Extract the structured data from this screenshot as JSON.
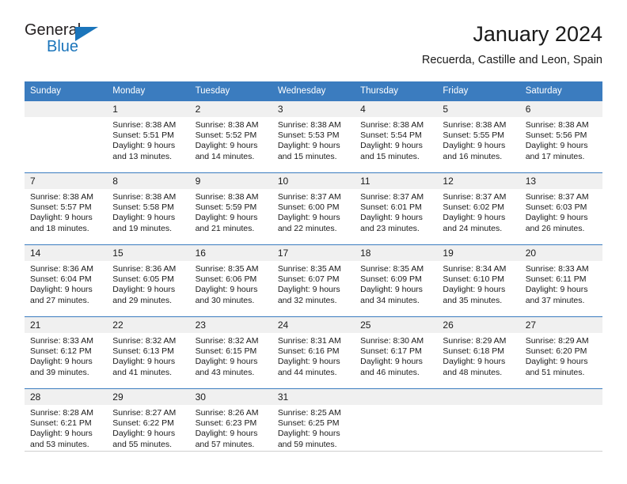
{
  "brand": {
    "name_part1": "General",
    "name_part2": "Blue",
    "triangle_color": "#1b75bb"
  },
  "header": {
    "title": "January 2024",
    "subtitle": "Recuerda, Castille and Leon, Spain"
  },
  "theme": {
    "header_bg": "#3b7cbf",
    "day_header_bg": "#f0f0f0",
    "text": "#1a1a1a"
  },
  "weekdays": [
    "Sunday",
    "Monday",
    "Tuesday",
    "Wednesday",
    "Thursday",
    "Friday",
    "Saturday"
  ],
  "weeks": [
    [
      {
        "day": "",
        "sunrise": "",
        "sunset": "",
        "daylight1": "",
        "daylight2": ""
      },
      {
        "day": "1",
        "sunrise": "Sunrise: 8:38 AM",
        "sunset": "Sunset: 5:51 PM",
        "daylight1": "Daylight: 9 hours",
        "daylight2": "and 13 minutes."
      },
      {
        "day": "2",
        "sunrise": "Sunrise: 8:38 AM",
        "sunset": "Sunset: 5:52 PM",
        "daylight1": "Daylight: 9 hours",
        "daylight2": "and 14 minutes."
      },
      {
        "day": "3",
        "sunrise": "Sunrise: 8:38 AM",
        "sunset": "Sunset: 5:53 PM",
        "daylight1": "Daylight: 9 hours",
        "daylight2": "and 15 minutes."
      },
      {
        "day": "4",
        "sunrise": "Sunrise: 8:38 AM",
        "sunset": "Sunset: 5:54 PM",
        "daylight1": "Daylight: 9 hours",
        "daylight2": "and 15 minutes."
      },
      {
        "day": "5",
        "sunrise": "Sunrise: 8:38 AM",
        "sunset": "Sunset: 5:55 PM",
        "daylight1": "Daylight: 9 hours",
        "daylight2": "and 16 minutes."
      },
      {
        "day": "6",
        "sunrise": "Sunrise: 8:38 AM",
        "sunset": "Sunset: 5:56 PM",
        "daylight1": "Daylight: 9 hours",
        "daylight2": "and 17 minutes."
      }
    ],
    [
      {
        "day": "7",
        "sunrise": "Sunrise: 8:38 AM",
        "sunset": "Sunset: 5:57 PM",
        "daylight1": "Daylight: 9 hours",
        "daylight2": "and 18 minutes."
      },
      {
        "day": "8",
        "sunrise": "Sunrise: 8:38 AM",
        "sunset": "Sunset: 5:58 PM",
        "daylight1": "Daylight: 9 hours",
        "daylight2": "and 19 minutes."
      },
      {
        "day": "9",
        "sunrise": "Sunrise: 8:38 AM",
        "sunset": "Sunset: 5:59 PM",
        "daylight1": "Daylight: 9 hours",
        "daylight2": "and 21 minutes."
      },
      {
        "day": "10",
        "sunrise": "Sunrise: 8:37 AM",
        "sunset": "Sunset: 6:00 PM",
        "daylight1": "Daylight: 9 hours",
        "daylight2": "and 22 minutes."
      },
      {
        "day": "11",
        "sunrise": "Sunrise: 8:37 AM",
        "sunset": "Sunset: 6:01 PM",
        "daylight1": "Daylight: 9 hours",
        "daylight2": "and 23 minutes."
      },
      {
        "day": "12",
        "sunrise": "Sunrise: 8:37 AM",
        "sunset": "Sunset: 6:02 PM",
        "daylight1": "Daylight: 9 hours",
        "daylight2": "and 24 minutes."
      },
      {
        "day": "13",
        "sunrise": "Sunrise: 8:37 AM",
        "sunset": "Sunset: 6:03 PM",
        "daylight1": "Daylight: 9 hours",
        "daylight2": "and 26 minutes."
      }
    ],
    [
      {
        "day": "14",
        "sunrise": "Sunrise: 8:36 AM",
        "sunset": "Sunset: 6:04 PM",
        "daylight1": "Daylight: 9 hours",
        "daylight2": "and 27 minutes."
      },
      {
        "day": "15",
        "sunrise": "Sunrise: 8:36 AM",
        "sunset": "Sunset: 6:05 PM",
        "daylight1": "Daylight: 9 hours",
        "daylight2": "and 29 minutes."
      },
      {
        "day": "16",
        "sunrise": "Sunrise: 8:35 AM",
        "sunset": "Sunset: 6:06 PM",
        "daylight1": "Daylight: 9 hours",
        "daylight2": "and 30 minutes."
      },
      {
        "day": "17",
        "sunrise": "Sunrise: 8:35 AM",
        "sunset": "Sunset: 6:07 PM",
        "daylight1": "Daylight: 9 hours",
        "daylight2": "and 32 minutes."
      },
      {
        "day": "18",
        "sunrise": "Sunrise: 8:35 AM",
        "sunset": "Sunset: 6:09 PM",
        "daylight1": "Daylight: 9 hours",
        "daylight2": "and 34 minutes."
      },
      {
        "day": "19",
        "sunrise": "Sunrise: 8:34 AM",
        "sunset": "Sunset: 6:10 PM",
        "daylight1": "Daylight: 9 hours",
        "daylight2": "and 35 minutes."
      },
      {
        "day": "20",
        "sunrise": "Sunrise: 8:33 AM",
        "sunset": "Sunset: 6:11 PM",
        "daylight1": "Daylight: 9 hours",
        "daylight2": "and 37 minutes."
      }
    ],
    [
      {
        "day": "21",
        "sunrise": "Sunrise: 8:33 AM",
        "sunset": "Sunset: 6:12 PM",
        "daylight1": "Daylight: 9 hours",
        "daylight2": "and 39 minutes."
      },
      {
        "day": "22",
        "sunrise": "Sunrise: 8:32 AM",
        "sunset": "Sunset: 6:13 PM",
        "daylight1": "Daylight: 9 hours",
        "daylight2": "and 41 minutes."
      },
      {
        "day": "23",
        "sunrise": "Sunrise: 8:32 AM",
        "sunset": "Sunset: 6:15 PM",
        "daylight1": "Daylight: 9 hours",
        "daylight2": "and 43 minutes."
      },
      {
        "day": "24",
        "sunrise": "Sunrise: 8:31 AM",
        "sunset": "Sunset: 6:16 PM",
        "daylight1": "Daylight: 9 hours",
        "daylight2": "and 44 minutes."
      },
      {
        "day": "25",
        "sunrise": "Sunrise: 8:30 AM",
        "sunset": "Sunset: 6:17 PM",
        "daylight1": "Daylight: 9 hours",
        "daylight2": "and 46 minutes."
      },
      {
        "day": "26",
        "sunrise": "Sunrise: 8:29 AM",
        "sunset": "Sunset: 6:18 PM",
        "daylight1": "Daylight: 9 hours",
        "daylight2": "and 48 minutes."
      },
      {
        "day": "27",
        "sunrise": "Sunrise: 8:29 AM",
        "sunset": "Sunset: 6:20 PM",
        "daylight1": "Daylight: 9 hours",
        "daylight2": "and 51 minutes."
      }
    ],
    [
      {
        "day": "28",
        "sunrise": "Sunrise: 8:28 AM",
        "sunset": "Sunset: 6:21 PM",
        "daylight1": "Daylight: 9 hours",
        "daylight2": "and 53 minutes."
      },
      {
        "day": "29",
        "sunrise": "Sunrise: 8:27 AM",
        "sunset": "Sunset: 6:22 PM",
        "daylight1": "Daylight: 9 hours",
        "daylight2": "and 55 minutes."
      },
      {
        "day": "30",
        "sunrise": "Sunrise: 8:26 AM",
        "sunset": "Sunset: 6:23 PM",
        "daylight1": "Daylight: 9 hours",
        "daylight2": "and 57 minutes."
      },
      {
        "day": "31",
        "sunrise": "Sunrise: 8:25 AM",
        "sunset": "Sunset: 6:25 PM",
        "daylight1": "Daylight: 9 hours",
        "daylight2": "and 59 minutes."
      },
      {
        "day": "",
        "sunrise": "",
        "sunset": "",
        "daylight1": "",
        "daylight2": ""
      },
      {
        "day": "",
        "sunrise": "",
        "sunset": "",
        "daylight1": "",
        "daylight2": ""
      },
      {
        "day": "",
        "sunrise": "",
        "sunset": "",
        "daylight1": "",
        "daylight2": ""
      }
    ]
  ]
}
